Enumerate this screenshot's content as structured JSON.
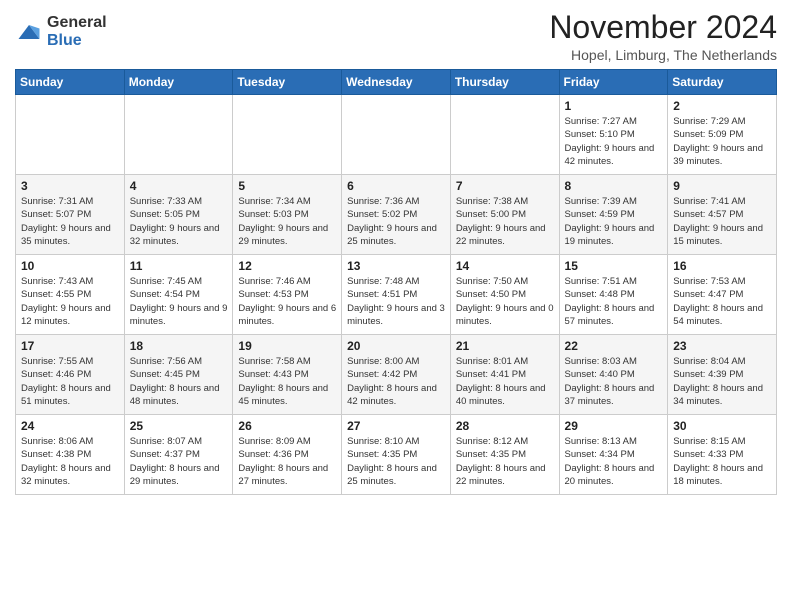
{
  "logo": {
    "general": "General",
    "blue": "Blue"
  },
  "header": {
    "month_title": "November 2024",
    "location": "Hopel, Limburg, The Netherlands"
  },
  "weekdays": [
    "Sunday",
    "Monday",
    "Tuesday",
    "Wednesday",
    "Thursday",
    "Friday",
    "Saturday"
  ],
  "weeks": [
    [
      {
        "day": "",
        "info": ""
      },
      {
        "day": "",
        "info": ""
      },
      {
        "day": "",
        "info": ""
      },
      {
        "day": "",
        "info": ""
      },
      {
        "day": "",
        "info": ""
      },
      {
        "day": "1",
        "info": "Sunrise: 7:27 AM\nSunset: 5:10 PM\nDaylight: 9 hours and 42 minutes."
      },
      {
        "day": "2",
        "info": "Sunrise: 7:29 AM\nSunset: 5:09 PM\nDaylight: 9 hours and 39 minutes."
      }
    ],
    [
      {
        "day": "3",
        "info": "Sunrise: 7:31 AM\nSunset: 5:07 PM\nDaylight: 9 hours and 35 minutes."
      },
      {
        "day": "4",
        "info": "Sunrise: 7:33 AM\nSunset: 5:05 PM\nDaylight: 9 hours and 32 minutes."
      },
      {
        "day": "5",
        "info": "Sunrise: 7:34 AM\nSunset: 5:03 PM\nDaylight: 9 hours and 29 minutes."
      },
      {
        "day": "6",
        "info": "Sunrise: 7:36 AM\nSunset: 5:02 PM\nDaylight: 9 hours and 25 minutes."
      },
      {
        "day": "7",
        "info": "Sunrise: 7:38 AM\nSunset: 5:00 PM\nDaylight: 9 hours and 22 minutes."
      },
      {
        "day": "8",
        "info": "Sunrise: 7:39 AM\nSunset: 4:59 PM\nDaylight: 9 hours and 19 minutes."
      },
      {
        "day": "9",
        "info": "Sunrise: 7:41 AM\nSunset: 4:57 PM\nDaylight: 9 hours and 15 minutes."
      }
    ],
    [
      {
        "day": "10",
        "info": "Sunrise: 7:43 AM\nSunset: 4:55 PM\nDaylight: 9 hours and 12 minutes."
      },
      {
        "day": "11",
        "info": "Sunrise: 7:45 AM\nSunset: 4:54 PM\nDaylight: 9 hours and 9 minutes."
      },
      {
        "day": "12",
        "info": "Sunrise: 7:46 AM\nSunset: 4:53 PM\nDaylight: 9 hours and 6 minutes."
      },
      {
        "day": "13",
        "info": "Sunrise: 7:48 AM\nSunset: 4:51 PM\nDaylight: 9 hours and 3 minutes."
      },
      {
        "day": "14",
        "info": "Sunrise: 7:50 AM\nSunset: 4:50 PM\nDaylight: 9 hours and 0 minutes."
      },
      {
        "day": "15",
        "info": "Sunrise: 7:51 AM\nSunset: 4:48 PM\nDaylight: 8 hours and 57 minutes."
      },
      {
        "day": "16",
        "info": "Sunrise: 7:53 AM\nSunset: 4:47 PM\nDaylight: 8 hours and 54 minutes."
      }
    ],
    [
      {
        "day": "17",
        "info": "Sunrise: 7:55 AM\nSunset: 4:46 PM\nDaylight: 8 hours and 51 minutes."
      },
      {
        "day": "18",
        "info": "Sunrise: 7:56 AM\nSunset: 4:45 PM\nDaylight: 8 hours and 48 minutes."
      },
      {
        "day": "19",
        "info": "Sunrise: 7:58 AM\nSunset: 4:43 PM\nDaylight: 8 hours and 45 minutes."
      },
      {
        "day": "20",
        "info": "Sunrise: 8:00 AM\nSunset: 4:42 PM\nDaylight: 8 hours and 42 minutes."
      },
      {
        "day": "21",
        "info": "Sunrise: 8:01 AM\nSunset: 4:41 PM\nDaylight: 8 hours and 40 minutes."
      },
      {
        "day": "22",
        "info": "Sunrise: 8:03 AM\nSunset: 4:40 PM\nDaylight: 8 hours and 37 minutes."
      },
      {
        "day": "23",
        "info": "Sunrise: 8:04 AM\nSunset: 4:39 PM\nDaylight: 8 hours and 34 minutes."
      }
    ],
    [
      {
        "day": "24",
        "info": "Sunrise: 8:06 AM\nSunset: 4:38 PM\nDaylight: 8 hours and 32 minutes."
      },
      {
        "day": "25",
        "info": "Sunrise: 8:07 AM\nSunset: 4:37 PM\nDaylight: 8 hours and 29 minutes."
      },
      {
        "day": "26",
        "info": "Sunrise: 8:09 AM\nSunset: 4:36 PM\nDaylight: 8 hours and 27 minutes."
      },
      {
        "day": "27",
        "info": "Sunrise: 8:10 AM\nSunset: 4:35 PM\nDaylight: 8 hours and 25 minutes."
      },
      {
        "day": "28",
        "info": "Sunrise: 8:12 AM\nSunset: 4:35 PM\nDaylight: 8 hours and 22 minutes."
      },
      {
        "day": "29",
        "info": "Sunrise: 8:13 AM\nSunset: 4:34 PM\nDaylight: 8 hours and 20 minutes."
      },
      {
        "day": "30",
        "info": "Sunrise: 8:15 AM\nSunset: 4:33 PM\nDaylight: 8 hours and 18 minutes."
      }
    ]
  ]
}
